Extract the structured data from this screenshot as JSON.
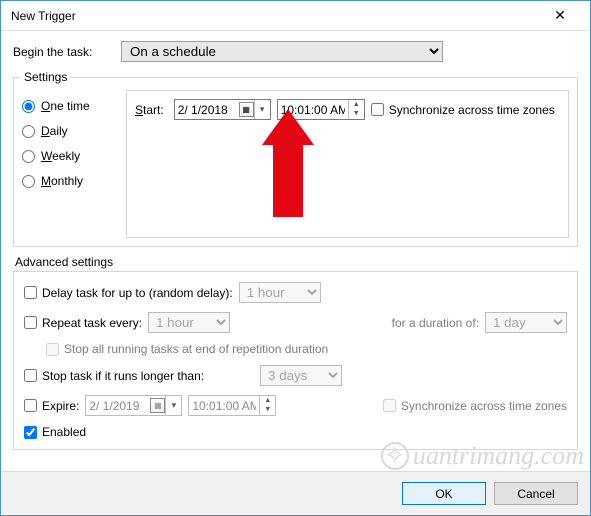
{
  "window": {
    "title": "New Trigger"
  },
  "begin": {
    "label": "Begin the task:",
    "value": "On a schedule"
  },
  "settings": {
    "legend": "Settings",
    "radios": {
      "onetime": "One time",
      "daily": "Daily",
      "weekly": "Weekly",
      "monthly": "Monthly",
      "selected": "onetime"
    },
    "start": {
      "label": "Start:",
      "date": "2/ 1/2018",
      "time": "10:01:00 AM",
      "sync": "Synchronize across time zones"
    }
  },
  "advanced": {
    "title": "Advanced settings",
    "delay": {
      "label": "Delay task for up to (random delay):",
      "value": "1 hour"
    },
    "repeat": {
      "label": "Repeat task every:",
      "value": "1 hour",
      "duration_label": "for a duration of:",
      "duration_value": "1 day"
    },
    "stopall": "Stop all running tasks at end of repetition duration",
    "stoplong": {
      "label": "Stop task if it runs longer than:",
      "value": "3 days"
    },
    "expire": {
      "label": "Expire:",
      "date": "2/ 1/2019",
      "time": "10:01:00 AM",
      "sync": "Synchronize across time zones"
    },
    "enabled": "Enabled"
  },
  "buttons": {
    "ok": "OK",
    "cancel": "Cancel"
  },
  "watermark": "uantrimang.com"
}
